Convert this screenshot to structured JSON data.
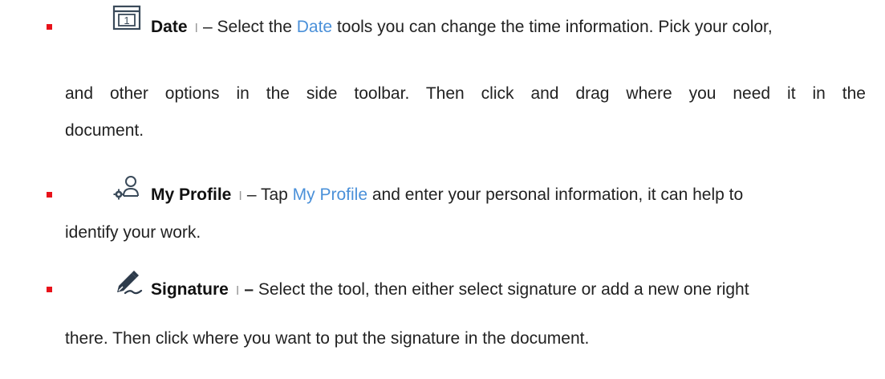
{
  "items": [
    {
      "icon": "calendar-icon",
      "title": "Date",
      "separator": "I",
      "dash": "–",
      "line1_pre": "Select the ",
      "line1_link": "Date",
      "line1_post": " tools you can change the time information. Pick your color,",
      "line2": "and other options in the side toolbar. Then click and drag where you need it in the",
      "line3": "document.",
      "calendar_day": "1"
    },
    {
      "icon": "user-settings-icon",
      "title": "My Profile",
      "separator": "I",
      "dash": "–",
      "line1_pre": "Tap ",
      "line1_link": "My Profile",
      "line1_post": " and enter your personal information, it can help to",
      "line2": "identify your work."
    },
    {
      "icon": "signature-pen-icon",
      "title": "Signature",
      "separator": "I",
      "dash": "–",
      "line1": "Select the tool, then either select signature or add a new one right",
      "line2": "there. Then click where you want to put the signature in the document."
    }
  ],
  "colors": {
    "bullet": "#e8121a",
    "link": "#4a90d9",
    "icon": "#3a4a5a"
  }
}
